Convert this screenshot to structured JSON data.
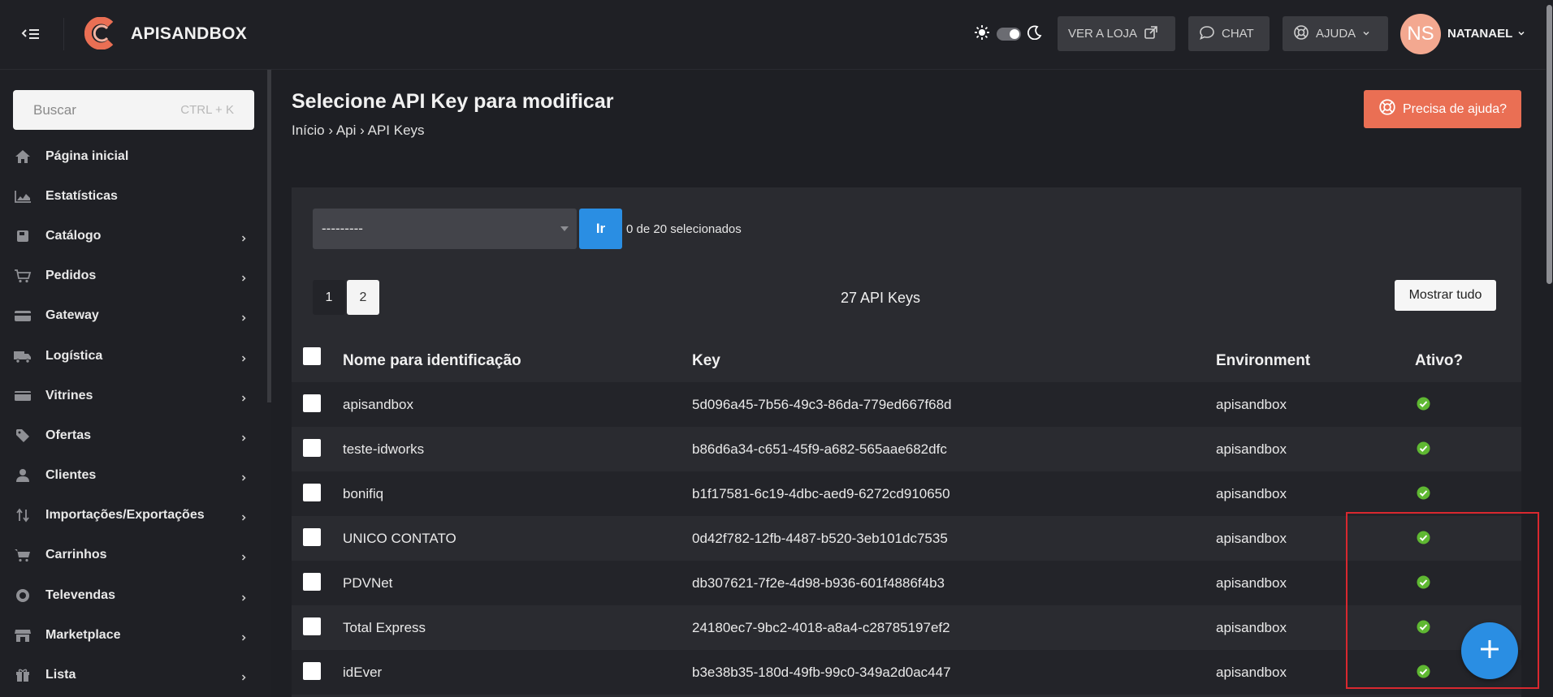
{
  "header": {
    "brand": "APISANDBOX",
    "buttons": {
      "loja": "VER A LOJA",
      "chat": "CHAT",
      "ajuda": "AJUDA"
    },
    "user": {
      "initials": "NS",
      "name": "NATANAEL"
    }
  },
  "sidebar": {
    "search_placeholder": "Buscar",
    "search_shortcut": "CTRL + K",
    "items": [
      {
        "label": "Página inicial",
        "icon": "home-icon",
        "has_children": false
      },
      {
        "label": "Estatísticas",
        "icon": "chart-icon",
        "has_children": false
      },
      {
        "label": "Catálogo",
        "icon": "book-icon",
        "has_children": true
      },
      {
        "label": "Pedidos",
        "icon": "cart-icon",
        "has_children": true
      },
      {
        "label": "Gateway",
        "icon": "credit-card-icon",
        "has_children": true
      },
      {
        "label": "Logística",
        "icon": "truck-icon",
        "has_children": true
      },
      {
        "label": "Vitrines",
        "icon": "showcase-icon",
        "has_children": true
      },
      {
        "label": "Ofertas",
        "icon": "tag-icon",
        "has_children": true
      },
      {
        "label": "Clientes",
        "icon": "user-icon",
        "has_children": true
      },
      {
        "label": "Importações/Exportações",
        "icon": "import-export-icon",
        "has_children": true
      },
      {
        "label": "Carrinhos",
        "icon": "cart-icon",
        "has_children": true
      },
      {
        "label": "Televendas",
        "icon": "headset-icon",
        "has_children": true
      },
      {
        "label": "Marketplace",
        "icon": "store-icon",
        "has_children": true
      },
      {
        "label": "Lista",
        "icon": "gift-icon",
        "has_children": true
      }
    ]
  },
  "main": {
    "title": "Selecione API Key para modificar",
    "breadcrumb": {
      "home": "Início",
      "sep1": "›",
      "app": "Api",
      "sep2": "›",
      "current": "API Keys"
    },
    "help_button": "Precisa de ajuda?",
    "actions": {
      "select_value": "---------",
      "go_label": "Ir",
      "selected_count": "0 de 20 selecionados"
    },
    "pagination": {
      "pages": [
        "1",
        "2"
      ],
      "current_page": "2",
      "result_count": "27 API Keys",
      "show_all": "Mostrar tudo"
    },
    "table": {
      "columns": [
        "Nome para identificação",
        "Key",
        "Environment",
        "Ativo?"
      ],
      "rows": [
        {
          "name": "apisandbox",
          "key": "5d096a45-7b56-49c3-86da-779ed667f68d",
          "environment": "apisandbox",
          "active": true
        },
        {
          "name": "teste-idworks",
          "key": "b86d6a34-c651-45f9-a682-565aae682dfc",
          "environment": "apisandbox",
          "active": true
        },
        {
          "name": "bonifiq",
          "key": "b1f17581-6c19-4dbc-aed9-6272cd910650",
          "environment": "apisandbox",
          "active": true
        },
        {
          "name": "UNICO CONTATO",
          "key": "0d42f782-12fb-4487-b520-3eb101dc7535",
          "environment": "apisandbox",
          "active": true
        },
        {
          "name": "PDVNet",
          "key": "db307621-7f2e-4d98-b936-601f4886f4b3",
          "environment": "apisandbox",
          "active": true
        },
        {
          "name": "Total Express",
          "key": "24180ec7-9bc2-4018-a8a4-c28785197ef2",
          "environment": "apisandbox",
          "active": true
        },
        {
          "name": "idEver",
          "key": "b3e38b35-180d-49fb-99c0-349a2d0ac447",
          "environment": "apisandbox",
          "active": true
        }
      ]
    }
  },
  "colors": {
    "accent_orange": "#ea6f54",
    "accent_blue": "#2a8ee3",
    "active_green": "#5fb832",
    "highlight_red": "#d9282f"
  }
}
